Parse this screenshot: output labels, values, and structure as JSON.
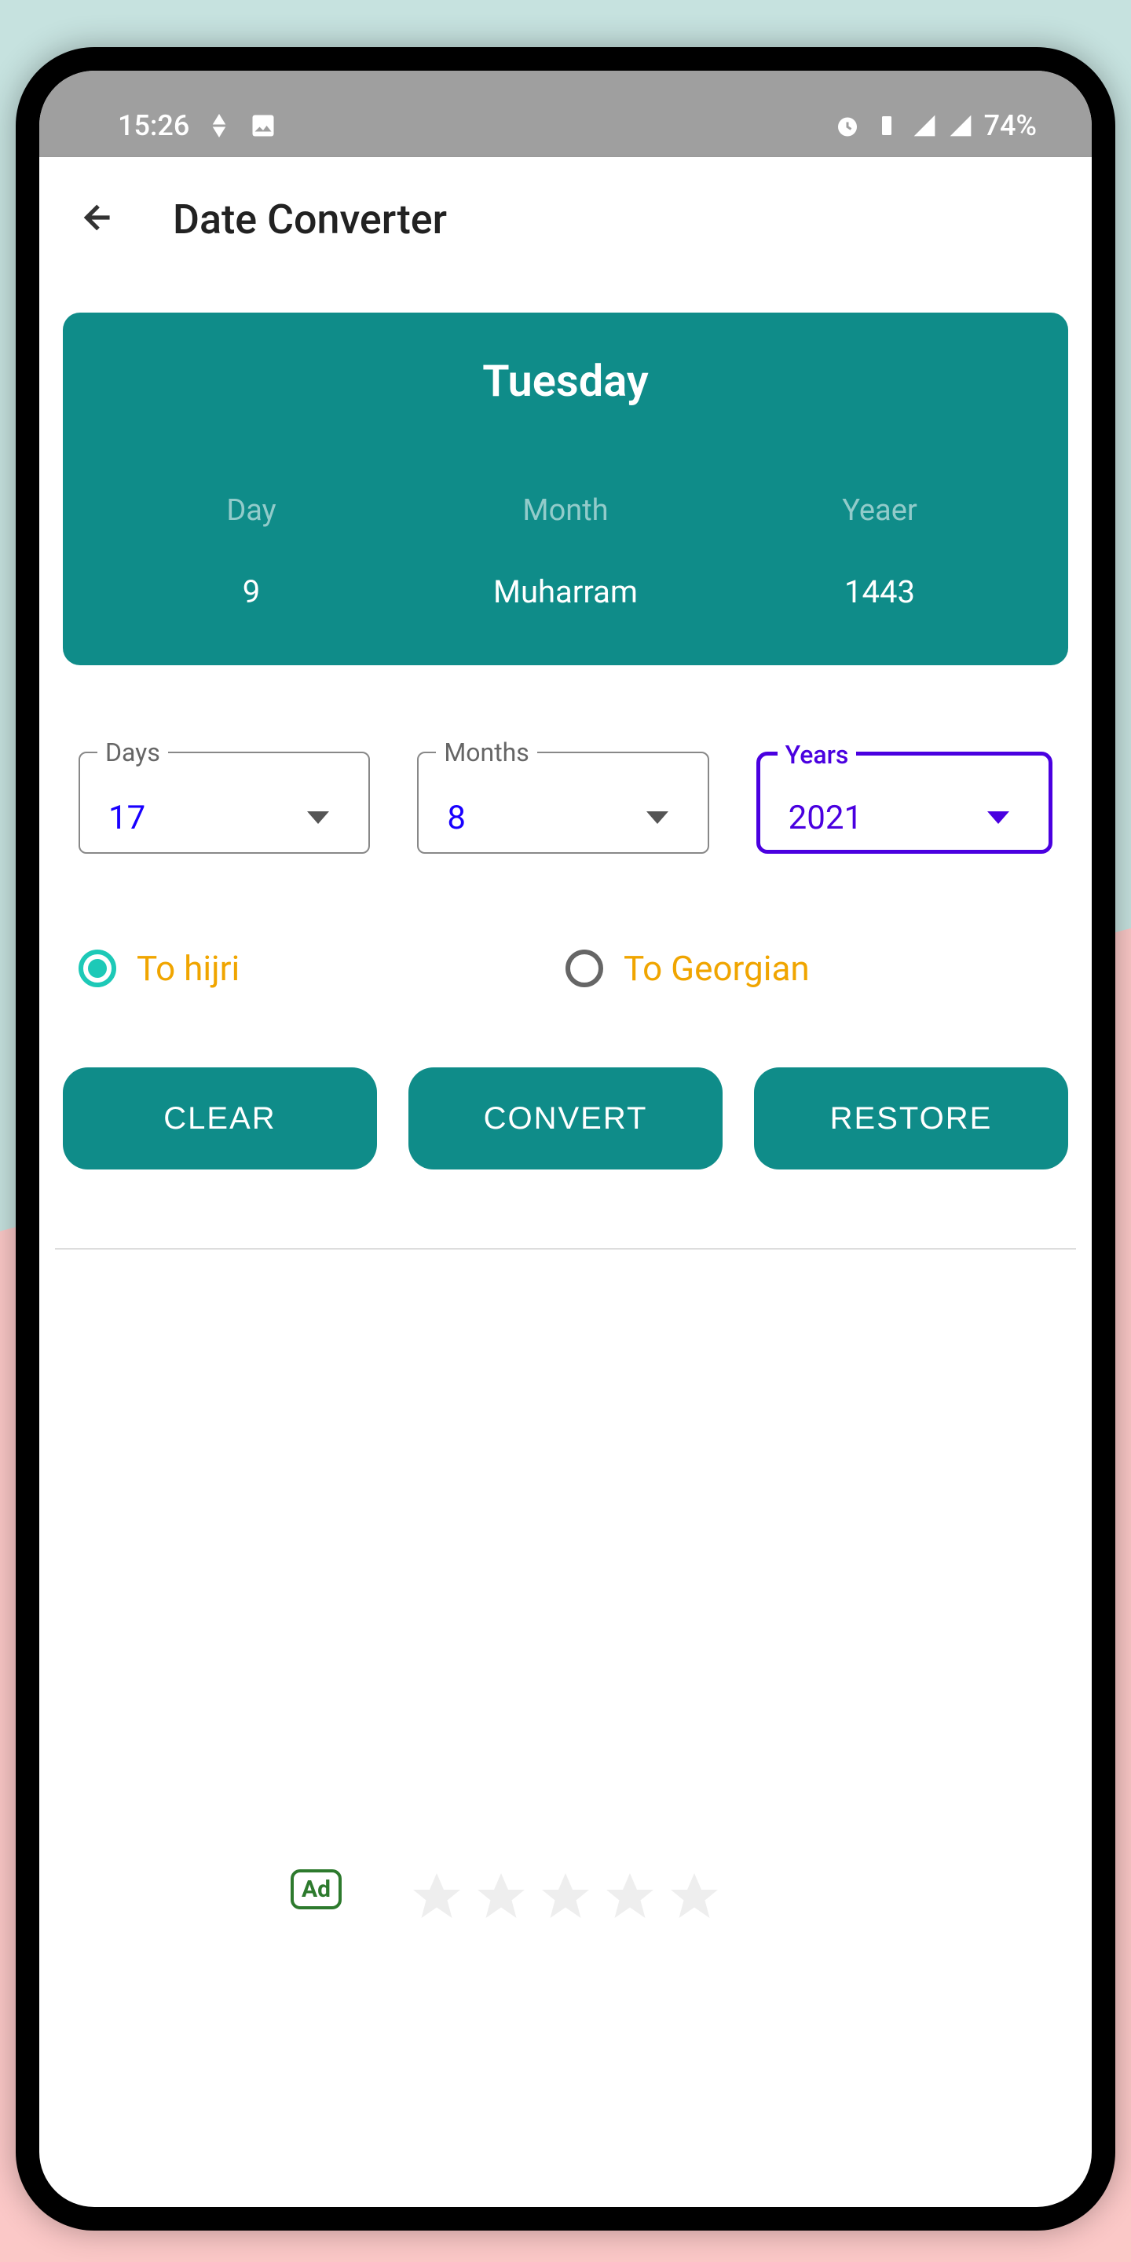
{
  "statusBar": {
    "time": "15:26",
    "battery": "74%"
  },
  "appBar": {
    "title": "Date Converter"
  },
  "result": {
    "weekday": "Tuesday",
    "dayLabel": "Day",
    "dayValue": "9",
    "monthLabel": "Month",
    "monthValue": "Muharram",
    "yearLabel": "Yeaer",
    "yearValue": "1443"
  },
  "selectors": {
    "days": {
      "label": "Days",
      "value": "17"
    },
    "months": {
      "label": "Months",
      "value": "8"
    },
    "years": {
      "label": "Years",
      "value": "2021"
    }
  },
  "radio": {
    "hijri": "To hijri",
    "georgian": "To Georgian"
  },
  "buttons": {
    "clear": "CLEAR",
    "convert": "CONVERT",
    "restore": "RESTORE"
  },
  "ad": {
    "label": "Ad"
  }
}
